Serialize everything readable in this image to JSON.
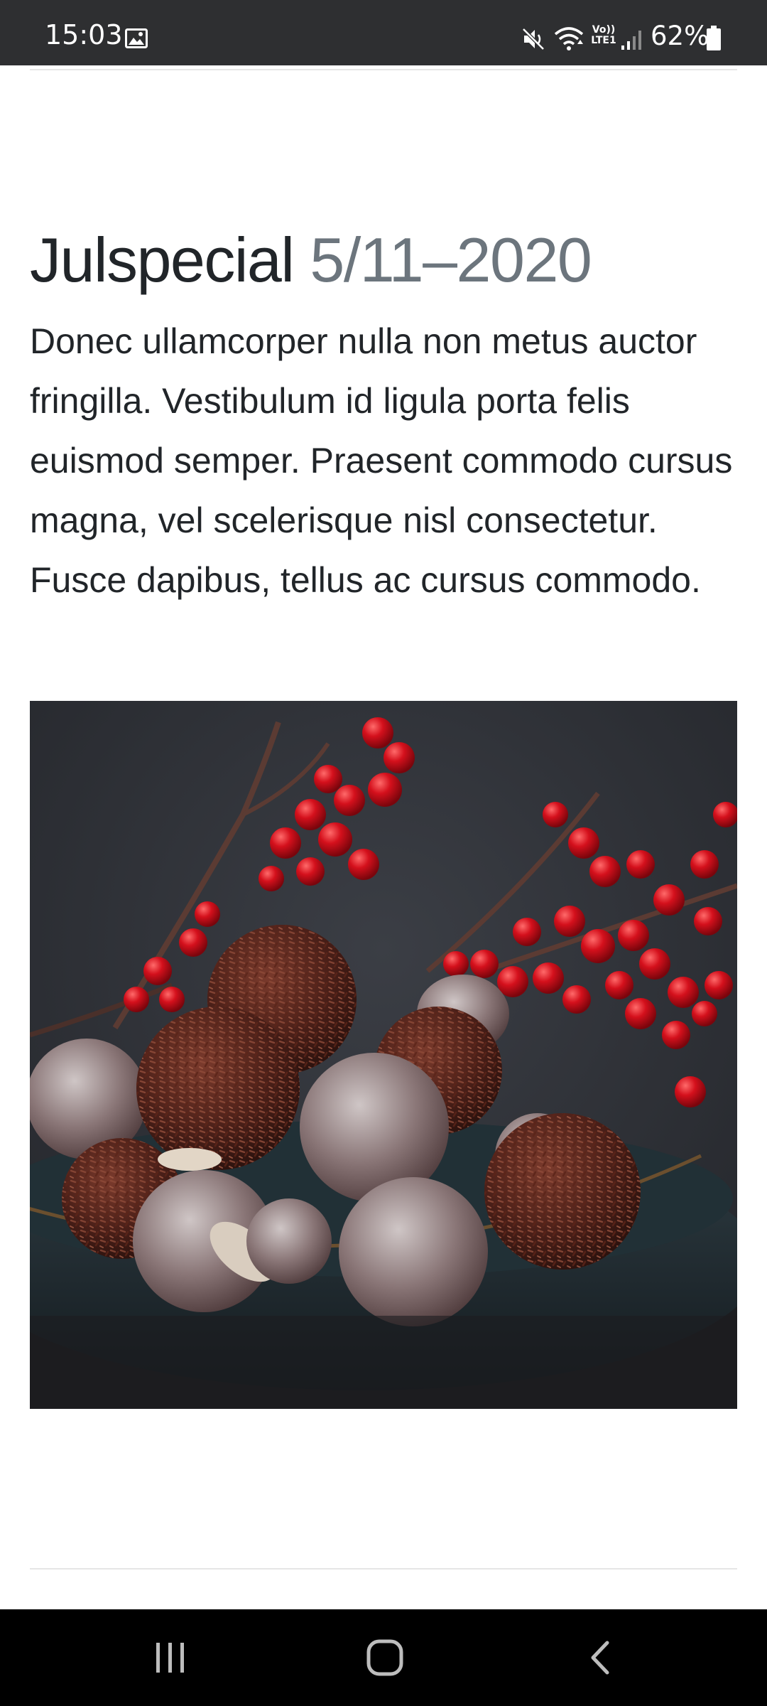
{
  "status_bar": {
    "time": "15:03",
    "battery": "62%",
    "volte_top": "Vo))",
    "volte_bottom": "LTE1",
    "icons": [
      "gallery-icon",
      "mute-icon",
      "wifi-icon",
      "volte-icon",
      "signal-icon",
      "battery-icon"
    ]
  },
  "article": {
    "title": "Julspecial",
    "date": "5/11–2020",
    "body": "Donec ullamcorper nulla non metus auctor fringilla. Vestibulum id ligula porta felis euismod semper. Praesent commodo cursus magna, vel scelerisque nisl consectetur. Fusce dapibus, tellus ac cursus commodo."
  },
  "colors": {
    "status_bar": "#2e2f31",
    "heading": "#212529",
    "muted": "#6c757d",
    "nav_bar": "#000000",
    "berry_red": "#d4101c"
  },
  "nav_bar": {
    "buttons": [
      "recents-icon",
      "home-icon",
      "back-icon"
    ]
  }
}
